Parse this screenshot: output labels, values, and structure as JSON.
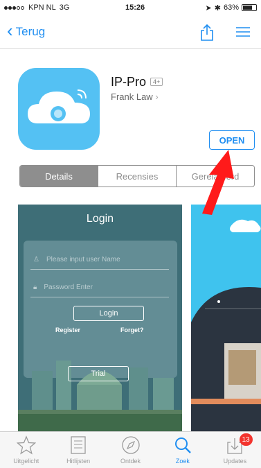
{
  "status_bar": {
    "carrier": "KPN NL",
    "network": "3G",
    "time": "15:26",
    "battery": "63%"
  },
  "nav": {
    "back_label": "Terug"
  },
  "app": {
    "name": "IP-Pro",
    "age_rating": "4+",
    "developer": "Frank Law",
    "open_label": "OPEN"
  },
  "segments": [
    {
      "label": "Details",
      "active": true
    },
    {
      "label": "Recensies",
      "active": false
    },
    {
      "label": "Gerelateerd",
      "active": false
    }
  ],
  "screenshot1": {
    "title": "Login",
    "username_placeholder": "Please input user Name",
    "password_placeholder": "Password Enter",
    "login_label": "Login",
    "register_label": "Register",
    "forgot_label": "Forget?",
    "trial_label": "Trial"
  },
  "tabbar": [
    {
      "label": "Uitgelicht",
      "icon": "star-icon"
    },
    {
      "label": "Hitlijsten",
      "icon": "list-icon"
    },
    {
      "label": "Ontdek",
      "icon": "compass-icon"
    },
    {
      "label": "Zoek",
      "icon": "search-icon",
      "active": true
    },
    {
      "label": "Updates",
      "icon": "updates-icon",
      "badge": "13"
    }
  ],
  "colors": {
    "accent": "#1f8ef1",
    "app_icon": "#54c1f3",
    "arrow": "#ff1a1a",
    "badge": "#f3342e"
  }
}
